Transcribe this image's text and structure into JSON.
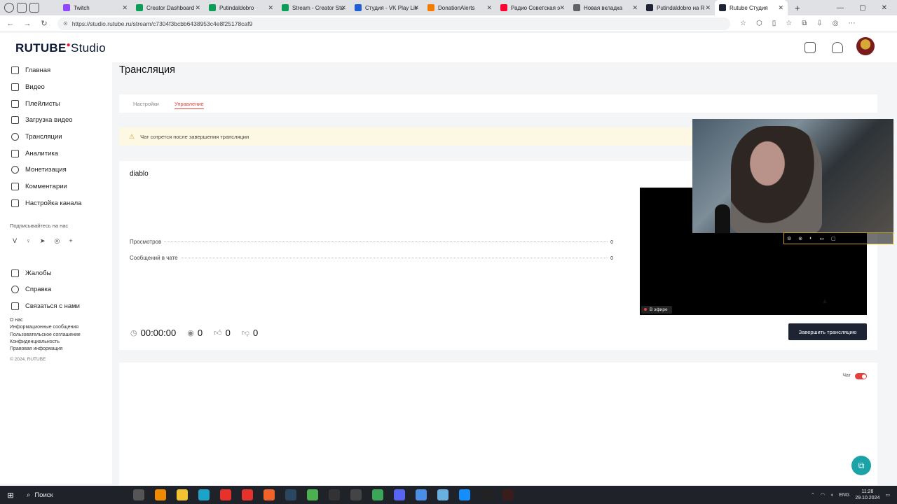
{
  "browser": {
    "tabs": [
      {
        "title": "Twitch",
        "color": "#9146ff"
      },
      {
        "title": "Creator Dashboard",
        "color": "#0c9d58"
      },
      {
        "title": "Putindaldobro",
        "color": "#0c9d58"
      },
      {
        "title": "Stream - Creator Stu",
        "color": "#0c9d58"
      },
      {
        "title": "Студия - VK Play Liv",
        "color": "#1f5fd1"
      },
      {
        "title": "DonationAlerts",
        "color": "#f57c00"
      },
      {
        "title": "Радио Советская э",
        "color": "#ff0033"
      },
      {
        "title": "Новая вкладка",
        "color": "#5f6368"
      },
      {
        "title": "Putindaldobro на R",
        "color": "#1e2433"
      },
      {
        "title": "Rutube Студия",
        "color": "#1e2433",
        "active": true
      }
    ],
    "url": "https://studio.rutube.ru/stream/c7304f3bcbb6438953c4e8f25178caf9"
  },
  "header": {
    "logo_main": "RUTUBE",
    "logo_studio": "Studio"
  },
  "sidebar": {
    "items": [
      {
        "label": "Главная",
        "name": "home"
      },
      {
        "label": "Видео",
        "name": "video"
      },
      {
        "label": "Плейлисты",
        "name": "playlists"
      },
      {
        "label": "Загрузка видео",
        "name": "upload"
      },
      {
        "label": "Трансляции",
        "name": "streams"
      },
      {
        "label": "Аналитика",
        "name": "analytics"
      },
      {
        "label": "Монетизация",
        "name": "monetization"
      },
      {
        "label": "Комментарии",
        "name": "comments"
      },
      {
        "label": "Настройка канала",
        "name": "channel-settings"
      }
    ],
    "subscribe_label": "Подписывайтесь на нас",
    "socials": [
      "vk",
      "ok",
      "telegram",
      "viber",
      "plus"
    ],
    "support_items": [
      {
        "label": "Жалобы",
        "name": "complaints"
      },
      {
        "label": "Справка",
        "name": "help"
      },
      {
        "label": "Связаться с нами",
        "name": "contact"
      }
    ],
    "footer_links": [
      "О нас",
      "Информационные сообщения",
      "Пользовательское соглашение",
      "Конфиденциальность",
      "Правовая информация"
    ],
    "copyright": "© 2024, RUTUBE"
  },
  "main": {
    "page_title": "Трансляция",
    "tabs": [
      "Настройки",
      "Управление"
    ],
    "active_tab": "Управление",
    "warning_text": "Чат сотрется после завершения трансляции",
    "stream": {
      "title": "diablo",
      "stats": [
        {
          "label": "Просмотров",
          "value": "0"
        },
        {
          "label": "Сообщений в чате",
          "value": "0"
        }
      ],
      "timer": "00:00:00",
      "viewers": "0",
      "likes": "0",
      "dislikes": "0",
      "live_label": "В эфире",
      "end_button": "Завершить трансляцию"
    },
    "chat": {
      "label": "Чат",
      "enabled": true
    }
  },
  "taskbar": {
    "search_label": "Поиск",
    "language": "ENG",
    "time": "11:28",
    "date": "29.10.2024"
  },
  "colors": {
    "accent": "#e2423f",
    "dark_button": "#1e2433",
    "warning_bg": "#fdf8e4",
    "help_fab": "#1ba3a8"
  }
}
